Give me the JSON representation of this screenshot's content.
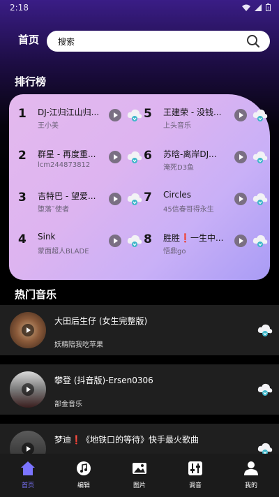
{
  "status": {
    "time": "2:18"
  },
  "header": {
    "home": "首页",
    "search_placeholder": "搜索"
  },
  "ranking": {
    "title": "排行榜",
    "items": [
      {
        "num": "1",
        "title": "DJ-江归江山归...",
        "artist": "王小美"
      },
      {
        "num": "2",
        "title": "群星 - 再度重...",
        "artist": "lcm244873812"
      },
      {
        "num": "3",
        "title": "吉特巴 - 望爱...",
        "artist": "堕落ˇ使者"
      },
      {
        "num": "4",
        "title": "Sink",
        "artist": "蒙面超人BLADE"
      },
      {
        "num": "5",
        "title": "王建荣 - 没钱...",
        "artist": "上头音乐"
      },
      {
        "num": "6",
        "title": "苏晗-离岸DJ...",
        "artist": "淹死D3鱼"
      },
      {
        "num": "7",
        "title": "Circles",
        "artist": "45信春哥得永生"
      },
      {
        "num": "8",
        "title": "胜胜❗一生中...",
        "artist": "悟鼎go"
      }
    ]
  },
  "hot": {
    "title": "热门音乐",
    "items": [
      {
        "title": "大田后生仔 (女生完整版)",
        "artist": "妖精陪我吃苹果"
      },
      {
        "title": "攀登 (抖音版)-Ersen0306",
        "artist": "部金音乐"
      },
      {
        "title": "梦迪❗《地铁口的等待》快手最火歌曲",
        "artist": ""
      }
    ]
  },
  "nav": {
    "items": [
      {
        "label": "首页",
        "icon": "home-icon"
      },
      {
        "label": "编辑",
        "icon": "music-note-icon"
      },
      {
        "label": "图片",
        "icon": "image-icon"
      },
      {
        "label": "调音",
        "icon": "equalizer-icon"
      },
      {
        "label": "我的",
        "icon": "person-icon"
      }
    ]
  },
  "colors": {
    "accent": "#7b74ff",
    "card_gradient_start": "#e4b9ee",
    "card_gradient_end": "#a99cf5"
  }
}
